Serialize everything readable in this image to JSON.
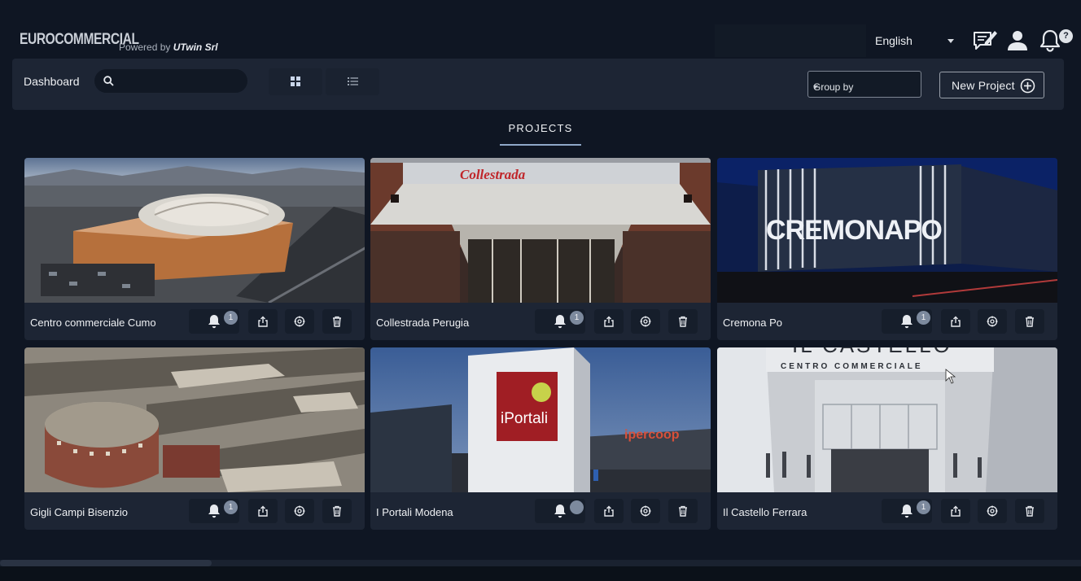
{
  "brand": {
    "name": "EUROCOMMERCIAL",
    "powered_prefix": "Powered by ",
    "powered_company": "UTwin Srl"
  },
  "header": {
    "language": "English",
    "help_badge": "?"
  },
  "toolbar": {
    "dashboard_label": "Dashboard",
    "search_value": "",
    "group_by": "Group by",
    "new_project_label": "New Project"
  },
  "tabs": {
    "projects": "PROJECTS"
  },
  "projects": [
    {
      "name": "Centro commerciale Cumo",
      "notifications": "1"
    },
    {
      "name": "Collestrada Perugia",
      "notifications": "1"
    },
    {
      "name": "Cremona Po",
      "notifications": "1"
    },
    {
      "name": "Gigli Campi Bisenzio",
      "notifications": "1"
    },
    {
      "name": "I Portali Modena",
      "notifications": ""
    },
    {
      "name": "Il Castello Ferrara",
      "notifications": "1"
    }
  ],
  "image_text": {
    "collestrada_sign": "Collestrada",
    "cremona_sign": "CREMONAPO",
    "portali_sign": "iPortali",
    "ipercoop_sign": "ipercoop",
    "castello_sign": "IL CASTELLO",
    "castello_sub": "CENTRO COMMERCIALE"
  },
  "colors": {
    "background": "#0f1623",
    "panel": "#1d2534",
    "accent": "#8fa8c8"
  }
}
